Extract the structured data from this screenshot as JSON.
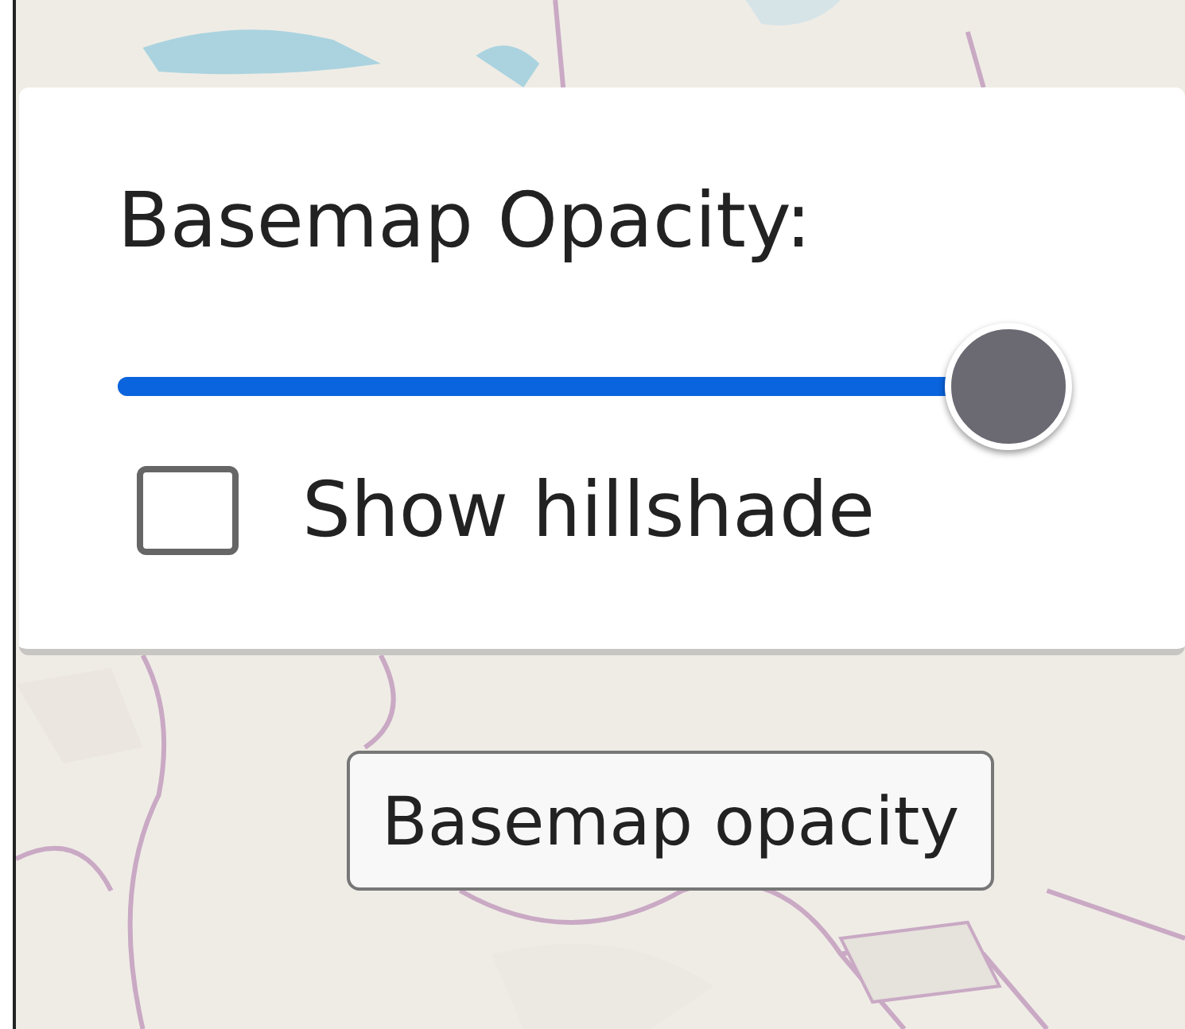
{
  "panel": {
    "title": "Basemap Opacity:",
    "slider": {
      "level": 1
    },
    "checkbox": {
      "label": "Show hillshade",
      "checked": false
    }
  },
  "tooltip": {
    "text": "Basemap opacity"
  }
}
